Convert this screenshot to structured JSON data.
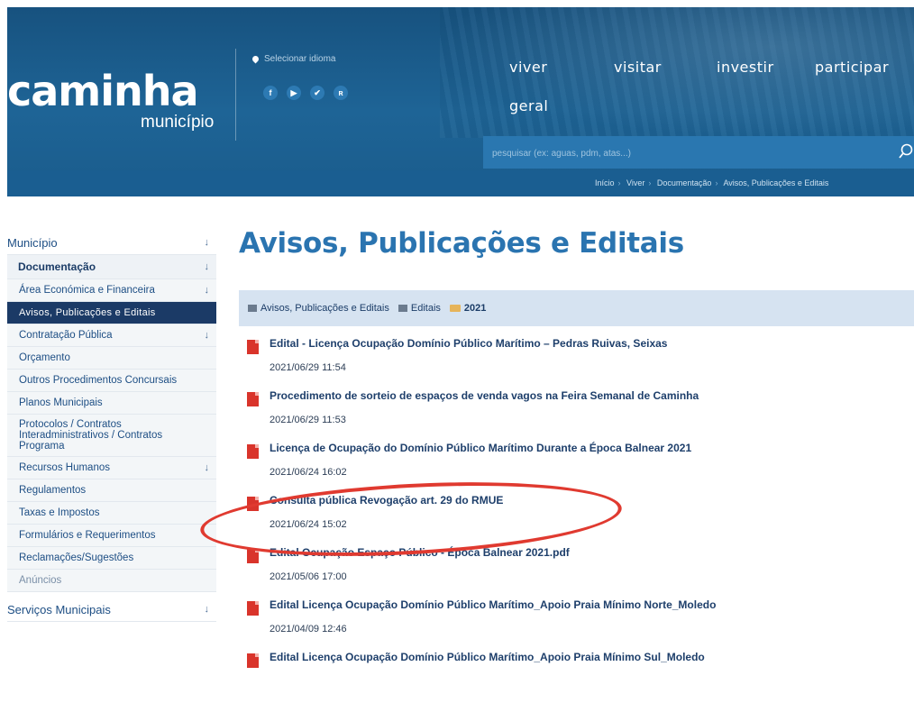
{
  "header": {
    "logo_word": "caminha",
    "logo_sub": "município",
    "language_label": "Selecionar idioma",
    "socials": [
      {
        "icon": "facebook-icon",
        "glyph": "f"
      },
      {
        "icon": "youtube-icon",
        "glyph": "▶"
      },
      {
        "icon": "twitter-icon",
        "glyph": "✔"
      },
      {
        "icon": "rss-icon",
        "glyph": "ʀ"
      }
    ],
    "nav": [
      "viver",
      "visitar",
      "investir",
      "participar",
      "geral"
    ],
    "search_placeholder": "pesquisar (ex: aguas, pdm, atas...)",
    "breadcrumb": [
      "Início",
      "Viver",
      "Documentação",
      "Avisos, Publicações e Editais"
    ]
  },
  "sidebar": {
    "items": [
      {
        "label": "Município",
        "arrow": "↓"
      },
      {
        "label": "Documentação",
        "arrow": "↓"
      },
      {
        "label": "Área Económica e Financeira",
        "arrow": "↓"
      },
      {
        "label": "Avisos, Publicações e Editais"
      },
      {
        "label": "Contratação Pública",
        "arrow": "↓"
      },
      {
        "label": "Orçamento"
      },
      {
        "label": "Outros Procedimentos Concursais"
      },
      {
        "label": "Planos Municipais"
      },
      {
        "label": "Protocolos / Contratos Interadministrativos / Contratos Programa"
      },
      {
        "label": "Recursos Humanos",
        "arrow": "↓"
      },
      {
        "label": "Regulamentos"
      },
      {
        "label": "Taxas e Impostos"
      },
      {
        "label": "Formulários e Requerimentos"
      },
      {
        "label": "Reclamações/Sugestões"
      },
      {
        "label": "Anúncios"
      },
      {
        "label": "Serviços Municipais",
        "arrow": "↓"
      }
    ]
  },
  "main": {
    "title": "Avisos, Publicações e Editais",
    "crumbs": [
      "Avisos, Publicações e Editais",
      "Editais",
      "2021"
    ],
    "documents": [
      {
        "title": "Edital - Licença Ocupação Domínio Público Marítimo – Pedras Ruivas, Seixas",
        "date": "2021/06/29 11:54"
      },
      {
        "title": "Procedimento de sorteio de espaços de venda vagos na Feira Semanal de Caminha",
        "date": "2021/06/29 11:53"
      },
      {
        "title": "Licença de Ocupação do Domínio Público Marítimo Durante a Época Balnear 2021",
        "date": "2021/06/24 16:02"
      },
      {
        "title": "Consulta pública Revogação art. 29 do RMUE",
        "date": "2021/06/24 15:02"
      },
      {
        "title": "Edital Ocupação Espaço Público - Época Balnear 2021.pdf",
        "date": "2021/05/06 17:00"
      },
      {
        "title": "Edital Licença Ocupação Domínio Público Marítimo_Apoio Praia Mínimo Norte_Moledo",
        "date": "2021/04/09 12:46"
      },
      {
        "title": "Edital Licença Ocupação Domínio Público Marítimo_Apoio Praia Mínimo Sul_Moledo",
        "date": ""
      }
    ]
  },
  "colors": {
    "header_bg": "#1e6496",
    "title_blue": "#2a74b0",
    "sidebar_active": "#1b3a66",
    "crumb_bar": "#d6e3f1",
    "pdf_red": "#d9342b",
    "highlight_red": "#e03a30"
  }
}
